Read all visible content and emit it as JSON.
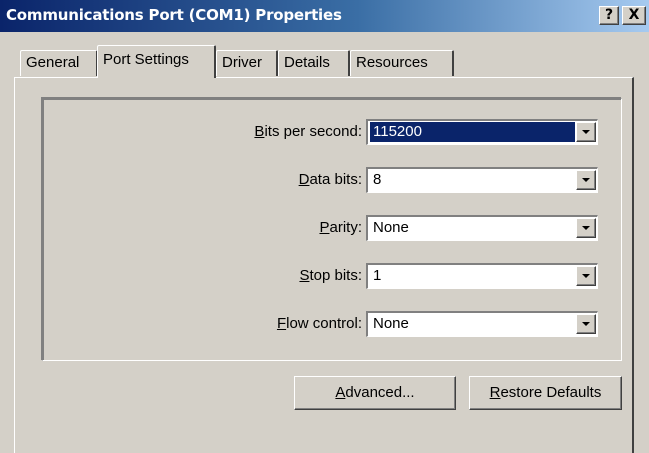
{
  "window": {
    "title": "Communications Port (COM1) Properties",
    "help_glyph": "?",
    "close_glyph": "X"
  },
  "tabs": [
    {
      "label": "General",
      "active": false
    },
    {
      "label": "Port Settings",
      "active": true
    },
    {
      "label": "Driver",
      "active": false
    },
    {
      "label": "Details",
      "active": false
    },
    {
      "label": "Resources",
      "active": false
    }
  ],
  "fields": [
    {
      "label_mnemonic": "B",
      "label_rest": "its per second:",
      "value": "115200",
      "selected": true
    },
    {
      "label_mnemonic": "D",
      "label_rest": "ata bits:",
      "value": "8",
      "selected": false
    },
    {
      "label_pre": "",
      "label_mnemonic": "P",
      "label_rest": "arity:",
      "value": "None",
      "selected": false
    },
    {
      "label_mnemonic": "S",
      "label_rest": "top bits:",
      "value": "1",
      "selected": false
    },
    {
      "label_mnemonic": "F",
      "label_rest": "low control:",
      "value": "None",
      "selected": false
    }
  ],
  "buttons": {
    "advanced_mnemonic": "A",
    "advanced_rest": "dvanced...",
    "restore_mnemonic": "R",
    "restore_rest": "estore Defaults"
  },
  "colors": {
    "face": "#d4d0c8",
    "title_start": "#0a246a",
    "title_end": "#a6caf0",
    "selection": "#0a246a"
  }
}
